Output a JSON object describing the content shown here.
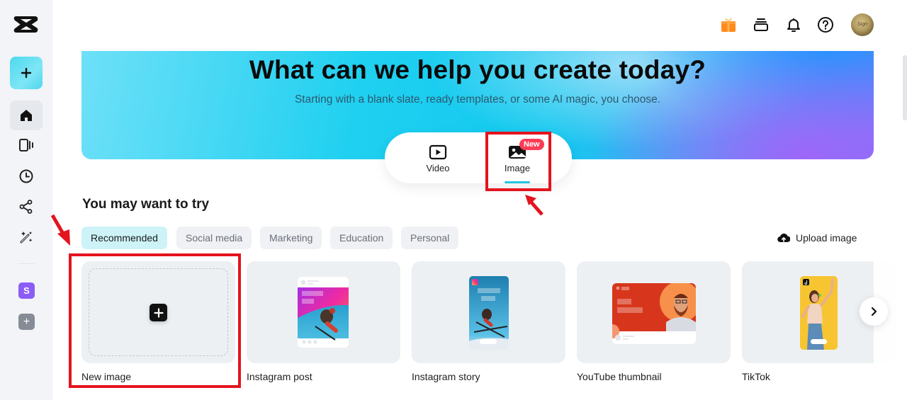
{
  "sidebar": {
    "logo": "capcut-logo",
    "create_button_icon": "plus-icon",
    "nav_items": [
      {
        "name": "home",
        "icon": "home-icon",
        "active": true
      },
      {
        "name": "templates",
        "icon": "video-templates-icon",
        "active": false
      },
      {
        "name": "recent",
        "icon": "clock-icon",
        "active": false
      },
      {
        "name": "shared",
        "icon": "share-icon",
        "active": false
      },
      {
        "name": "magic-tools",
        "icon": "magic-wand-icon",
        "active": false
      }
    ],
    "space_badge": "S",
    "add_space": "+"
  },
  "topbar": {
    "icons": [
      "gift-icon",
      "layers-icon",
      "bell-icon",
      "help-icon"
    ],
    "avatar": "user-avatar",
    "avatar_text": "Sign"
  },
  "hero": {
    "title": "What can we help you create today?",
    "subtitle": "Starting with a blank slate, ready templates, or some AI magic, you choose.",
    "colors": {
      "start": "#6ee0f8",
      "mid": "#12c8ef",
      "end": "#9a66f6"
    }
  },
  "mode_switch": {
    "tabs": [
      {
        "label": "Video",
        "icon": "play-icon",
        "active": false
      },
      {
        "label": "Image",
        "icon": "image-icon",
        "active": true
      }
    ],
    "badge": "New",
    "accent": "#25c5e0"
  },
  "section": {
    "title": "You may want to try",
    "chips": [
      {
        "label": "Recommended",
        "active": true
      },
      {
        "label": "Social media",
        "active": false
      },
      {
        "label": "Marketing",
        "active": false
      },
      {
        "label": "Education",
        "active": false
      },
      {
        "label": "Personal",
        "active": false
      }
    ],
    "upload_label": "Upload image",
    "cards": [
      {
        "label": "New image",
        "kind": "blank"
      },
      {
        "label": "Instagram post",
        "kind": "instagram-post"
      },
      {
        "label": "Instagram story",
        "kind": "instagram-story"
      },
      {
        "label": "YouTube thumbnail",
        "kind": "youtube-thumbnail"
      },
      {
        "label": "TikTok",
        "kind": "tiktok"
      }
    ]
  },
  "annotations": {
    "highlight_color": "#e4141e"
  }
}
